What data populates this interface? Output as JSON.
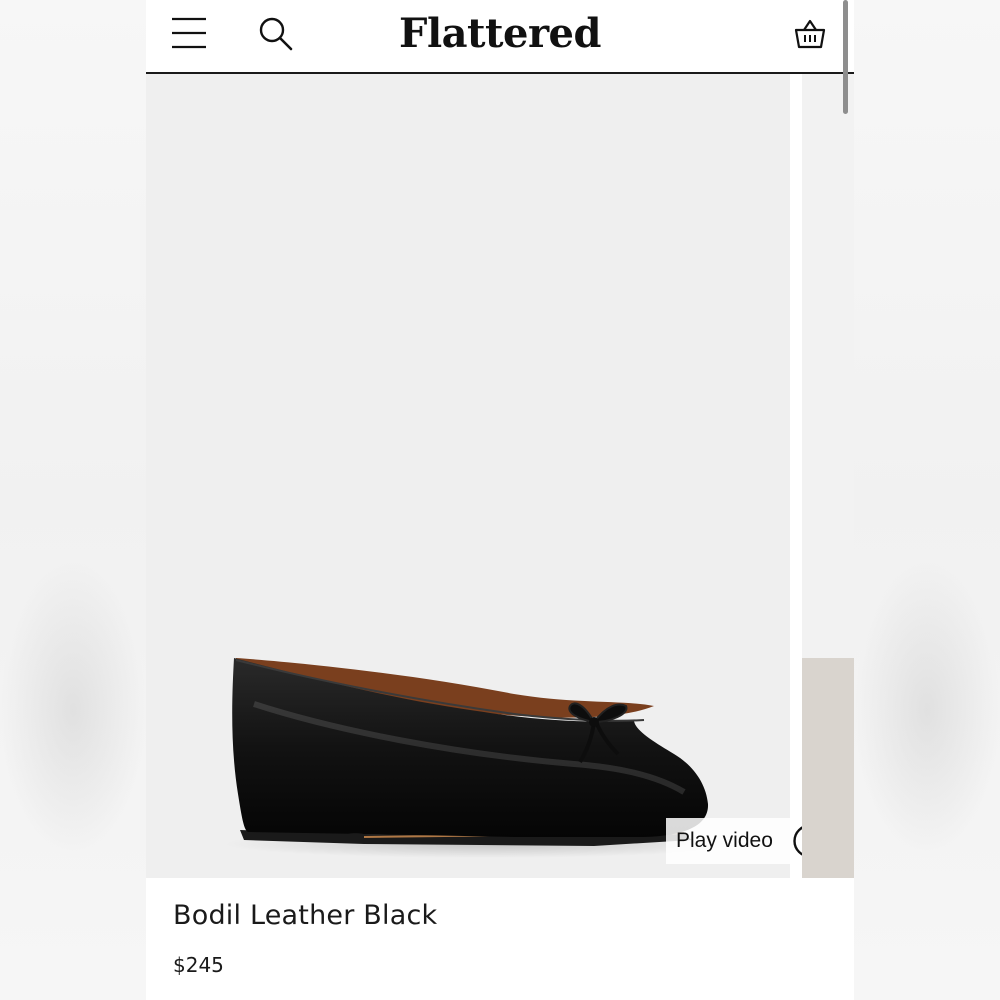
{
  "header": {
    "brand": "Flattered",
    "menu_icon": "hamburger-menu-icon",
    "search_icon": "search-icon",
    "cart_icon": "shopping-basket-icon"
  },
  "product": {
    "name": "Bodil Leather Black",
    "price": "$245",
    "play_video_label": "Play video",
    "play_icon": "play-circle-icon"
  },
  "colors": {
    "text": "#111111",
    "background": "#ffffff",
    "image_bg": "#efefef"
  }
}
